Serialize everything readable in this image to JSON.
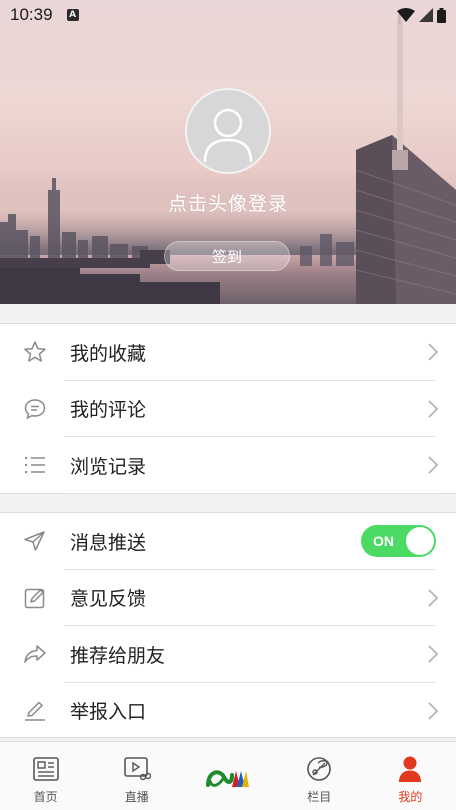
{
  "status_bar": {
    "time": "10:39",
    "notification_badge": "A"
  },
  "profile": {
    "login_prompt": "点击头像登录",
    "signin_label": "签到"
  },
  "menu_group_1": [
    {
      "label": "我的收藏",
      "icon": "star-icon"
    },
    {
      "label": "我的评论",
      "icon": "comment-icon"
    },
    {
      "label": "浏览记录",
      "icon": "list-icon"
    }
  ],
  "menu_group_2": [
    {
      "label": "消息推送",
      "icon": "send-icon",
      "toggle": "ON"
    },
    {
      "label": "意见反馈",
      "icon": "edit-icon"
    },
    {
      "label": "推荐给朋友",
      "icon": "share-icon"
    },
    {
      "label": "举报入口",
      "icon": "pencil-icon"
    }
  ],
  "bottom_nav": [
    {
      "label": "首页",
      "icon": "news-icon"
    },
    {
      "label": "直播",
      "icon": "video-icon"
    },
    {
      "label": "",
      "icon": "logo-icon"
    },
    {
      "label": "栏目",
      "icon": "column-icon"
    },
    {
      "label": "我的",
      "icon": "person-icon",
      "active": true
    }
  ],
  "colors": {
    "accent": "#e0391d",
    "toggle_on": "#4cd964",
    "background": "#f2f2f2"
  }
}
